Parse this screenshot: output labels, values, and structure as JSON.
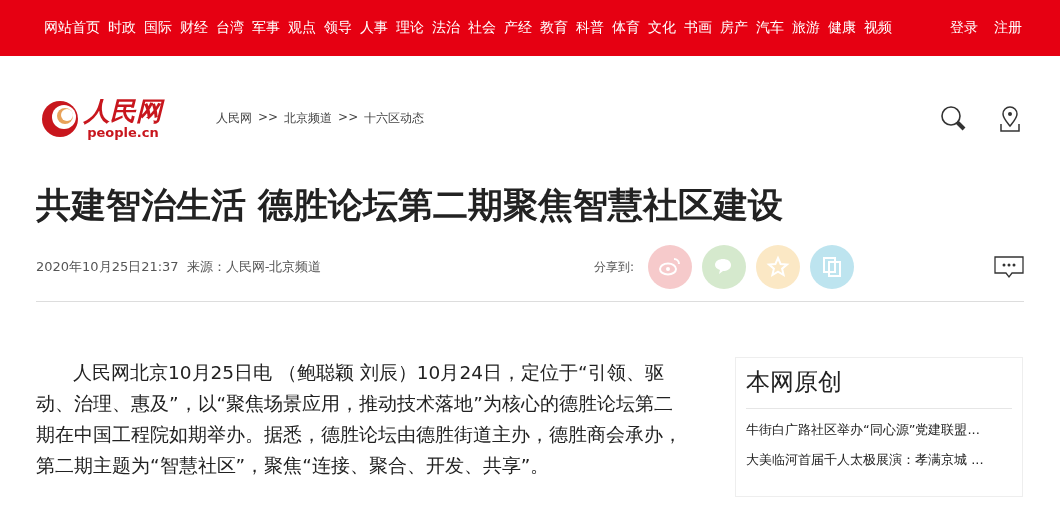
{
  "top_nav": {
    "items": [
      "网站首页",
      "时政",
      "国际",
      "财经",
      "台湾",
      "军事",
      "观点",
      "领导",
      "人事",
      "理论",
      "法治",
      "社会",
      "产经",
      "教育",
      "科普",
      "体育",
      "文化",
      "书画",
      "房产",
      "汽车",
      "旅游",
      "健康",
      "视频"
    ],
    "account": [
      "登录",
      "注册"
    ]
  },
  "logo": {
    "name": "人民网",
    "domain": "people.cn"
  },
  "breadcrumb": [
    {
      "label": "人民网",
      "separator": ">>"
    },
    {
      "label": "北京频道",
      "separator": ">>"
    },
    {
      "label": "十六区动态"
    }
  ],
  "article": {
    "title": "共建智治生活 德胜论坛第二期聚焦智慧社区建设",
    "datetime": "2020年10月25日21:37",
    "source": "来源：人民网-北京频道",
    "share_label": "分享到:",
    "share_buttons": [
      {
        "kind": "swirl",
        "color": "#f6cacb"
      },
      {
        "kind": "chat",
        "color": "#d5e9cd"
      },
      {
        "kind": "star",
        "color": "#fbe8c5"
      },
      {
        "kind": "copy",
        "color": "#bde4ef"
      }
    ],
    "body": "人民网北京10月25日电 （鲍聪颖 刘辰）10月24日，定位于“引领、驱动、治理、惠及”，以“聚焦场景应用，推动技术落地”为核心的德胜论坛第二期在中国工程院如期举办。据悉，德胜论坛由德胜街道主办，德胜商会承办，第二期主题为“智慧社区”，聚焦“连接、聚合、开发、共享”。"
  },
  "sidebar": {
    "title": "本网原创",
    "items": [
      "牛街白广路社区举办“同心源”党建联盟...",
      "大美临河首届千人太极展演：孝满京城 ..."
    ]
  }
}
